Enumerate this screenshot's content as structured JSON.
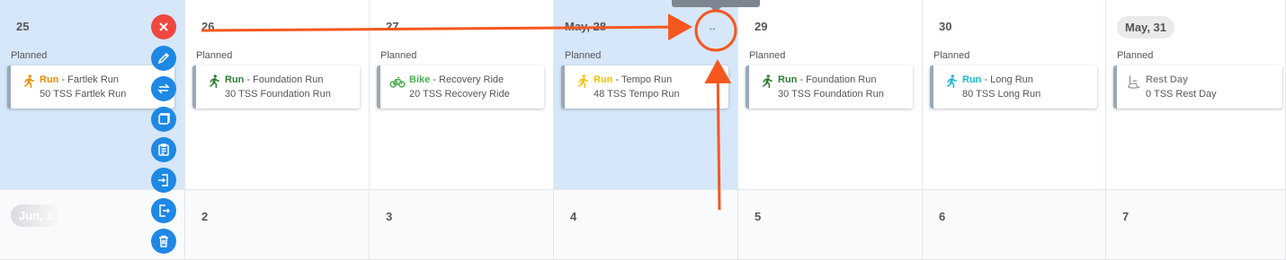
{
  "week1": [
    {
      "date": "25",
      "pill": false,
      "planned": "Planned",
      "sport": "Run",
      "workout": "Fartlek Run",
      "detail": "50 TSS Fartlek Run",
      "color": "#f08a00",
      "icon": "run-icon"
    },
    {
      "date": "26",
      "pill": false,
      "planned": "Planned",
      "sport": "Run",
      "workout": "Foundation Run",
      "detail": "30 TSS Foundation Run",
      "color": "#2e7d32",
      "icon": "run-icon"
    },
    {
      "date": "27",
      "pill": false,
      "planned": "Planned",
      "sport": "Bike",
      "workout": "Recovery Ride",
      "detail": "20 TSS Recovery Ride",
      "color": "#4caf50",
      "icon": "bike-icon"
    },
    {
      "date": "May, 28",
      "pill": false,
      "planned": "Planned",
      "sport": "Run",
      "workout": "Tempo Run",
      "detail": "48 TSS Tempo Run",
      "color": "#f2c200",
      "icon": "run-icon"
    },
    {
      "date": "29",
      "pill": false,
      "planned": "Planned",
      "sport": "Run",
      "workout": "Foundation Run",
      "detail": "30 TSS Foundation Run",
      "color": "#2e7d32",
      "icon": "run-icon"
    },
    {
      "date": "30",
      "pill": false,
      "planned": "Planned",
      "sport": "Run",
      "workout": "Long Run",
      "detail": "80 TSS Long Run",
      "color": "#19b8d8",
      "icon": "run-icon"
    },
    {
      "date": "May, 31",
      "pill": true,
      "planned": "Planned",
      "sport": "Rest Day",
      "workout": "",
      "detail": "0 TSS Rest Day",
      "color": "#888888",
      "icon": "rest-day-icon"
    }
  ],
  "week2": [
    {
      "date": "Jun, 1",
      "pill": true
    },
    {
      "date": "2",
      "pill": false
    },
    {
      "date": "3",
      "pill": false
    },
    {
      "date": "4",
      "pill": false
    },
    {
      "date": "5",
      "pill": false
    },
    {
      "date": "6",
      "pill": false
    },
    {
      "date": "7",
      "pill": false
    }
  ],
  "actions": [
    "delete-icon",
    "edit-icon",
    "swap-icon",
    "copy-icon",
    "paste-icon",
    "import-icon",
    "export-icon",
    "trash-icon"
  ],
  "drag_handle_symbol": "↔",
  "colors": {
    "selected": "#d6e7fa",
    "action": "#1e88e5",
    "delete": "#f0483e",
    "annotation": "#f5571f"
  }
}
